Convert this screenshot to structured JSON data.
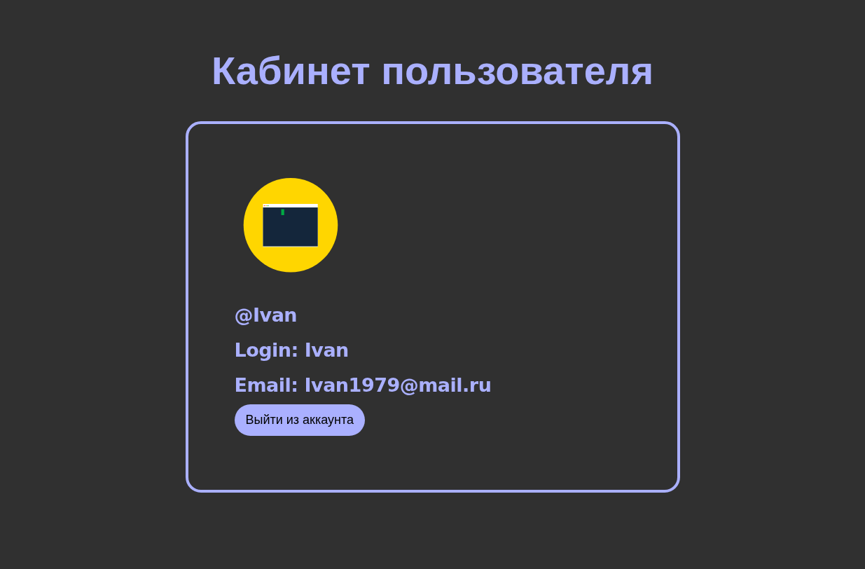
{
  "title": "Кабинет пользователя",
  "profile": {
    "handle": "@Ivan",
    "fields": [
      {
        "label": "Login:",
        "value": "Ivan"
      },
      {
        "label": "Email:",
        "value": "Ivan1979@mail.ru"
      }
    ],
    "logout_button": "Выйти из аккаунта"
  }
}
